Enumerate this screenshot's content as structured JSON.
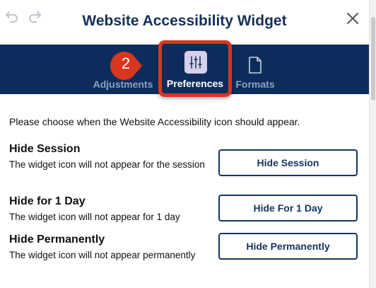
{
  "header": {
    "title": "Website Accessibility Widget",
    "undo_icon": "undo-icon",
    "redo_icon": "redo-icon",
    "close_icon": "close-icon"
  },
  "tabs": [
    {
      "label": "Adjustments",
      "icon": "adjustments-icon",
      "active": false
    },
    {
      "label": "Preferences",
      "icon": "sliders-icon",
      "active": true
    },
    {
      "label": "Formats",
      "icon": "document-icon",
      "active": false
    }
  ],
  "callout": {
    "number": "2",
    "color": "#d9361f"
  },
  "content": {
    "intro": "Please choose when the Website Accessibility icon should appear.",
    "options": [
      {
        "title": "Hide Session",
        "description": "The widget icon will not appear for the session",
        "button": "Hide Session"
      },
      {
        "title": "Hide for 1 Day",
        "description": "The widget icon will not appear for 1 day",
        "button": "Hide For 1 Day"
      },
      {
        "title": "Hide Permanently",
        "description": "The widget icon will not appear permanently",
        "button": "Hide Permanently"
      }
    ]
  },
  "colors": {
    "navy": "#0c2d5c",
    "title": "#15305a",
    "active_icon_bg": "#d6d0ea",
    "highlight": "#d9361f"
  }
}
